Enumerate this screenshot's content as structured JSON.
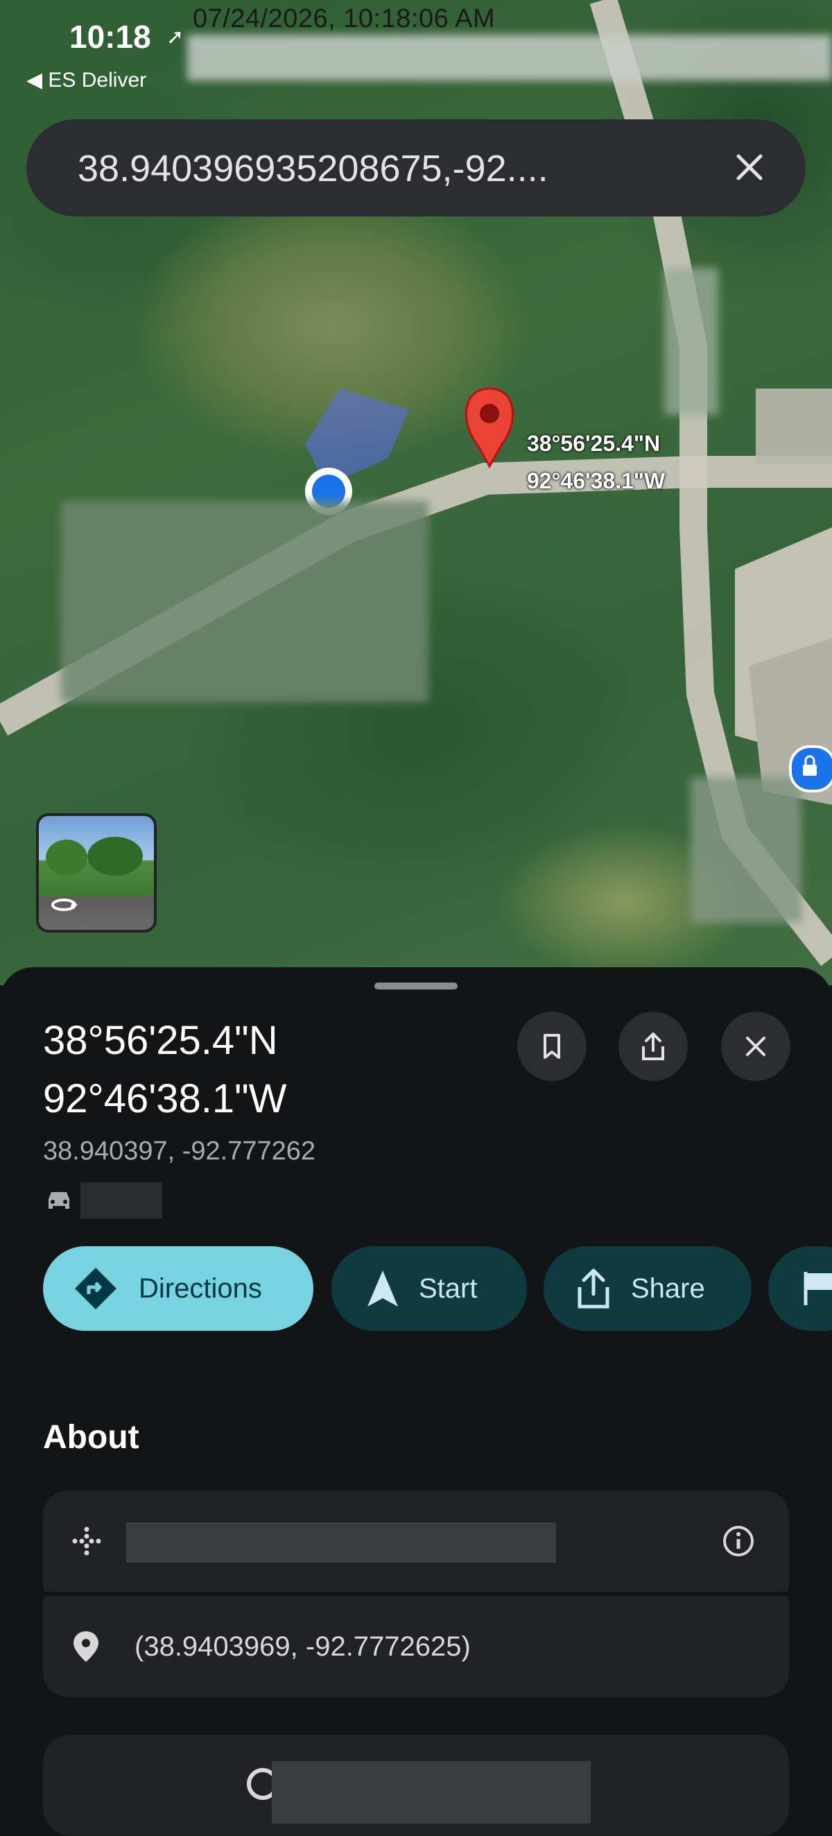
{
  "status_bar": {
    "time": "10:18",
    "timestamp": "07/24/2026, 10:18:06 AM",
    "back_app": "◀ ES Deliver"
  },
  "search": {
    "query": "38.940396935208675,-92...."
  },
  "map": {
    "pin_label_lat": "38°56'25.4\"N",
    "pin_label_lng": "92°46'38.1\"W",
    "pin_color": "#ea4335",
    "my_location_color": "#1a73e8"
  },
  "place": {
    "title_lat": "38°56'25.4\"N",
    "title_lng": "92°46'38.1\"W",
    "decimal_coords": "38.940397, -92.777262"
  },
  "actions": {
    "directions": "Directions",
    "start": "Start",
    "share": "Share"
  },
  "about": {
    "heading": "About",
    "coordinates": "(38.9403969, -92.7772625)"
  },
  "icons": [
    "bookmark-icon",
    "share-icon",
    "close-icon",
    "directions-icon",
    "navigation-arrow-icon",
    "car-icon",
    "plus-code-icon",
    "info-icon",
    "location-pin-icon",
    "street-view-icon"
  ]
}
